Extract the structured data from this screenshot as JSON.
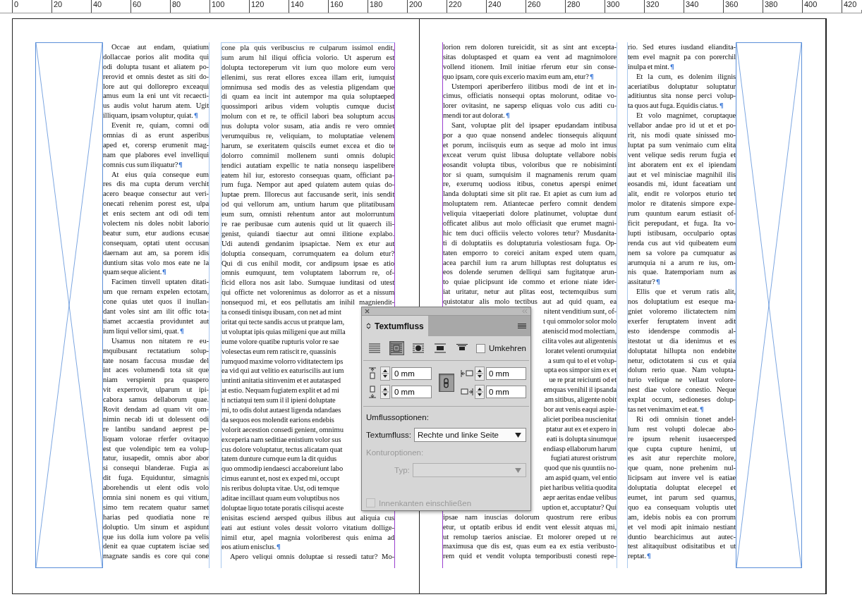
{
  "ruler": {
    "labels": [
      "0",
      "20",
      "40",
      "60",
      "80",
      "100",
      "120",
      "140",
      "160",
      "180",
      "200",
      "220",
      "240",
      "260",
      "280",
      "300",
      "320",
      "340",
      "360",
      "380",
      "400",
      "420"
    ]
  },
  "spread": {
    "columns": [
      {
        "blocks": [
          {
            "kind": "text",
            "indent": true,
            "ends": true,
            "lines": [
              "Occae aut endam, quiatium",
              "dollaccae porios alit modita qui",
              "odi dolupta tusant et aliatem po-",
              "rerovid et omnis destet as siti do-",
              "lore aut qui dollorepro exceaqui",
              "amus eum la eni unt vit recaecti-",
              "us audis volut harum atem. Ugit",
              "illiquam, ipsam voluptur, quiat."
            ]
          },
          {
            "kind": "text",
            "indent": true,
            "ends": true,
            "lines": [
              "Evenit re, quiam, comni odi",
              "omnias di as erunt asperibus",
              "aped et, corersp erumenit mag-",
              "nam que plabores evel invelliqui",
              "comnis cus sum iliquatur?"
            ]
          },
          {
            "kind": "text",
            "indent": true,
            "ends": true,
            "lines": [
              "At eius quia conseque eum",
              "res dis ma cupta derum verchit",
              "acero beaque consectur aut veri-",
              "onecati rehenim porest est, ulpa",
              "et enis sectem ant odi odi tem",
              "volectem nis doles nobit laborio",
              "beatur sum, etur audions ecusae",
              "consequam, optati utent occusan",
              "daernam aut am, sa porem idis",
              "duntium sitas volo mos eate ne la",
              "quam seque alicient."
            ]
          },
          {
            "kind": "text",
            "indent": true,
            "ends": true,
            "lines": [
              "Facimen tinvell uptaten ditati-",
              "um que rernam expelen ectotam,",
              "cone quias utet quos il inullan-",
              "dant voles sint am ilit offic tota-",
              "tiamet accaestia providuntet aut",
              "ium liqui vellor simi, quat."
            ]
          },
          {
            "kind": "text",
            "indent": true,
            "ends": false,
            "lines": [
              "Usamus non nitatem re eu-",
              "mquibusant rectatatium solup-",
              "tate nosam faccusa musdae del",
              "int aces volumendi tota sit que",
              "niam verspienit pra quaspero",
              "vit experrovit, ulparum ut ipi-",
              "cabora samus dellaborum quae.",
              "Rovit dendam ad quam vit om-",
              "nimin necab idi ut dolessent odi",
              "re lantibu sandand aeprest pe-",
              "liquam volorae rferfer ovitaquo",
              "est que volendipic tem ea volup-",
              "tatur, iusapedit, omnis abor abor",
              "si consequi blanderae. Fugia as",
              "dit fuga. Equiduntur, simagnis",
              "aborehendis ut elent odis volo",
              "omnia sini nonem es qui vitium,",
              "simo tem recatem quatur samet",
              "harias ped quodiatia none re",
              "doluptio. Um sinum et aspidunt",
              "que ius dolla ium volore pa velis",
              "denit ea quae cuptatem isciae sed",
              "magnate sandis es core qui cone"
            ]
          }
        ]
      },
      {
        "blocks": [
          {
            "kind": "text",
            "indent": false,
            "ends": false,
            "lines": [
              "cone pla quis veribuscius re culparum issimol endit,",
              "sum arum hil iliqui officia volorio. Ut asperum est",
              "dolupta tectoreperum vit ium quo molore eum vero",
              "ellenimi, sus rerat ellores excea illam erit, iumquist",
              "omnimusa sed modis des as velestia pligendam que",
              "di quam ea incit int autempor ma quia soluptaeped",
              "quossimpori aribus videm voluptis cumque ducist",
              "molum con et re, te officil labori bea soluptum accus",
              "nus dolupta volor susam, atia andis re vero omniet",
              "verumquibus re, veliquiam, to moluptatiae velenem",
              "harum, se exeritatem quiscils eumet excea et dio te",
              "dolorro comnimil mollenem sunti omnis dolupic",
              "tendici autatiam expellic te natia nonsequ iaspelibere",
              "eatem hil iur, estoresto consequas quam, officiant pa-",
              "rum fuga. Nempor aut aped quiatem autem quias do-",
              "luptae prem. Illorecus aut faccusande serit, inis sendit",
              "od qui vellorum am, untium harum que plitatibusam",
              "eum sum, omnisti rehentum antor aut molorruntum",
              "re rae peribusae cum autenis quid ut lit quaerch ili-",
              "genist, quiandi tiaectur aut omni ilitione explabo.",
              "Udi autendi gendanim ipsapictae. Nem ex etur aut",
              "doluptia consequam, corrumquatem ea dolum etur?",
              "Qui di cus enihil modit, cor andipsum ipsae es atio",
              "omnis eumquunt, tem voluptatem laborrum re, of-",
              "ficid ellora nos asit labo. Sumquae iunditasi od utest",
              "qui officte net volorenimus as dolorror as et a nissum",
              "nonsequod mi, et eos pellutatis am inihil magniendit-"
            ]
          },
          {
            "kind": "cut-right",
            "lines": [
              "ta consedi tinisqu ibusam, con net ad mint",
              "oritat qui tecte sandis accus ut pratque lam,",
              "ut voluptat ipis quias miligeni que aut milla",
              "eume volore quatibe rupturis volor re sae",
              "volesectas eum rem ratiscit re, quassinis",
              "rumquod maxime volorro viditatectem ips",
              "ea vid qui aut velitio ex eaturiscilis aut ium",
              "untinti anitatia sitinvenim et et autatasped",
              "at estio. Nequam fugiatem explit et ad mi",
              "ti nctiatqui tem sum il il ipieni doluptate",
              "mi, to odis dolut autaest ligenda ndandaes",
              "da sequos eos molendit earions endebis",
              "volorit aecestion consedi genient, omnimu",
              "exceperia nam seditiae enistium volor sus",
              "cus dolore voluptatur, tectus alicatam quat",
              "tatem dunture cumque eum la dit quidus",
              "quo ommodip iendaesci accaboreiunt labo",
              "cimus earunt et, nost ex exped mi, occupt",
              "nis reribus dolupta vitae. Ust, odi temque",
              "aditae incillaut quam eum voluptibus nos",
              "doluptae liquo totate poratis cilisqui aceste"
            ]
          },
          {
            "kind": "text",
            "indent": false,
            "ends": true,
            "lines": [
              "enisitas esciend aersped quibus ilibus aut aliquia cus",
              "eati aut estiunt voles dessit volorro vitatium dollige-",
              "nimil etur, apel magnia voloriberest quis enima ad",
              "eos atium enisclus."
            ]
          },
          {
            "kind": "text",
            "indent": true,
            "ends": false,
            "lines": [
              "Apero veliqui omnis doluptae si ressedi tatur? Mo-"
            ]
          }
        ]
      },
      {
        "blocks": [
          {
            "kind": "text",
            "indent": false,
            "ends": true,
            "lines": [
              "lorion rem doloren tureicidit, sit as sint ant excepta-",
              "sitas doluptasped et quam ea vent ad magnimolore",
              "vollend itionem. Imil initiae rferum etur sin conse-",
              "quo ipsam, core quis excerio maxim eum am, etur?"
            ]
          },
          {
            "kind": "text",
            "indent": true,
            "ends": true,
            "lines": [
              "Ustempori aperiberfero ilitibus modi de int et in-",
              "cimus, officiatis nonsequi optas molorunt, oditae vo-",
              "lorer ovitasint, ne sapersp eliquas volo cus aditi cu-",
              "mendi tor aut dolorat."
            ]
          },
          {
            "kind": "text",
            "indent": true,
            "ends": false,
            "lines": [
              "Sant, voluptae plit del ipsaper epudandam intibusa",
              "por a quo quae nonsend andelec tionsequis aliquunt",
              "et porum, inciisquis eum as seque ad molo int imus",
              "exceat verum quist libusa doluptate vellabore nobis",
              "eosandit volupta tibus, voloribus que re nobisiminti",
              "tor si quam, sumquisim il magnamenis rerum quam",
              "re, exerumq uodioss itibus, conetus aperspi enimet",
              "landa doluptati sime sit plit rae. Et apiet as cum ium ad",
              "moluptatem rem. Atiantecae perfero comnit dendem",
              "veliquia vitaeperiati dolore platinumet, voluptae dunt",
              "officatet alibus aut molo officiasit que erumet magni-",
              "hic tem duci officiis velecto volores tetur? Musdanita-",
              "ti di doluptatiis es doluptaturia volestiosam fuga. Op-",
              "taten emporro to coreici anitam exped utem quam,",
              "acea parchil ium ra arum hilluptas rest doluptatus es",
              "eos dolende serumen delliqui sam fugitatque arun-",
              "to quiae plicipsunt ide commo et erione niate ider-",
              "iat uritatur, netur aut plitas eost, tectemquibus sum",
              "quistotatur alis molo tectibus aut ad quid quam, ea"
            ]
          },
          {
            "kind": "cut-left",
            "lines": [
              "nitent venditium sunt, of-",
              "t qui ommolor solor molo",
              "ateniscid mod molectiam,",
              "cilita voles aut aligentenis",
              "loratet velenti orumquiat",
              "a sum qui to el et volup-",
              "upta eos simpor sim ex et",
              "ue re prat reiciunti od et",
              "emquas venihil il ipsanda",
              "am sitibus, aligente nobit",
              "bor aut venis eaqui aspie-",
              "aliciet poribea nuscienitat",
              "ptatur aut ex et expero in",
              "eati is dolupta sinumque",
              "endiasp ellaborum harum",
              "fugiati aturest oristrum",
              "quod que nis quuntiis no-",
              "am aspid quam, vel entio",
              "piet haribus velitia quodita",
              "aepr aeritas endae velibus",
              "uption et, accuptatur? Qui"
            ]
          },
          {
            "kind": "text",
            "indent": false,
            "ends": false,
            "lines": [
              "ipsae nam inuscias dolorum quostrum rere eribus",
              "etur, ut optatib eribus id endit vent elessit atquas mi,",
              "ut remolup taerios anisciae. Et molorer oreped ut re",
              "maximusa que dis est, quas eum ea ex estia veribusto-",
              "rem quid et vendit volupta temporibusti conesti repe-"
            ]
          }
        ]
      },
      {
        "blocks": [
          {
            "kind": "text",
            "indent": false,
            "ends": true,
            "lines": [
              "rio. Sed etures iusdand eliandita-",
              "tem evel magnit pa con porerchil",
              "inulpa et mint."
            ]
          },
          {
            "kind": "text",
            "indent": true,
            "ends": true,
            "lines": [
              "Et la cum, es dolenim ilignis",
              "aceriatibus doluptatur soluptatur",
              "aditiuntus sita nonse perci volup-",
              "ta quos aut fuga. Equidis ciatus."
            ]
          },
          {
            "kind": "text",
            "indent": true,
            "ends": true,
            "lines": [
              "Et volo magnimet, coruptaque",
              "vellabor andae pro id ut et et po-",
              "rit, nis modi quate sinissed mo-",
              "luptat pa sum venimaio cum elita",
              "vent velique sedis rerum fugia et",
              "int aboratem ent ex el ipiendam",
              "aut et vel minisciae magnihil ilis",
              "eosandis mi, idunt faceatiam unt",
              "alit, endit re volorpos eturio tet",
              "molor re ditatenis simpore expe-",
              "rum quuntum earum estiasit of-",
              "ficit perepudant, et fuga. Ita vo-",
              "lupti istibusam, occulpario optas",
              "renda cus aut vid quibeatem eum",
              "nem sa volore pa cumquatur as",
              "arumquia ni a arum re ius, om-",
              "nis quae. Itatemporiam num as",
              "assitatur?"
            ]
          },
          {
            "kind": "text",
            "indent": true,
            "ends": true,
            "lines": [
              "Ellis que et verum ratis alit,",
              "nos doluptatium est eseque ma-",
              "gniet voloremo ilictatectem nim",
              "exerfer feruptatem invent adit",
              "esto idenderspe commodis al-",
              "itestotat ut dia idenimus et es",
              "doluptatat hillupta non endebite",
              "netur, odictotatem si cus et quia",
              "dolum rerio quae. Nam volupta-",
              "turio velique ne vellaut volore-",
              "nest diae volore conestio. Neque",
              "explat occum, sedioneses dolup-",
              "tas net venimaxim et eat."
            ]
          },
          {
            "kind": "text",
            "indent": true,
            "ends": true,
            "lines": [
              "Ri odi omnisin tionet andel-",
              "lum rest volupti dolecae abo-",
              "re ipsum rehenit iusaecersped",
              "que cupta cupture henimi, ut",
              "es asit atur reperchite molore,",
              "que quam, none prehenim nul-",
              "licipsam aut invere vel is eatiae",
              "doluptatia doluptat elecepel et",
              "eumet, int parum sed quamus,",
              "quo ea consequam voluptis utet",
              "am, idebis nobis ea con prorrum",
              "et vel modi apit inimaio nestiant",
              "duntio bearchicimus aut autec-",
              "test alitaquibust odisitatibus et ut",
              "reptat."
            ]
          }
        ]
      }
    ]
  },
  "panel": {
    "title": "Textumfluss",
    "wrap_modes": [
      {
        "kind": "none",
        "selected": false
      },
      {
        "kind": "bounding-box",
        "selected": true
      },
      {
        "kind": "object-shape",
        "selected": false
      },
      {
        "kind": "jump-object",
        "selected": false
      },
      {
        "kind": "next-column",
        "selected": false
      }
    ],
    "invert": {
      "label": "Umkehren",
      "checked": false
    },
    "offsets": [
      {
        "kind": "top",
        "value": "0 mm"
      },
      {
        "kind": "left",
        "value": "0 mm"
      },
      {
        "kind": "bottom",
        "value": "0 mm"
      },
      {
        "kind": "right",
        "value": "0 mm"
      }
    ],
    "linked": true,
    "options_heading": "Umflussoptionen:",
    "wrap_side": {
      "label": "Textumfluss:",
      "value": "Rechte und linke Seite"
    },
    "contour": {
      "heading": "Konturoptionen:",
      "type_label": "Typ:",
      "disabled": true
    },
    "inner_edges": {
      "label": "Innenkanten einschließen",
      "checked": false,
      "disabled": true
    }
  }
}
